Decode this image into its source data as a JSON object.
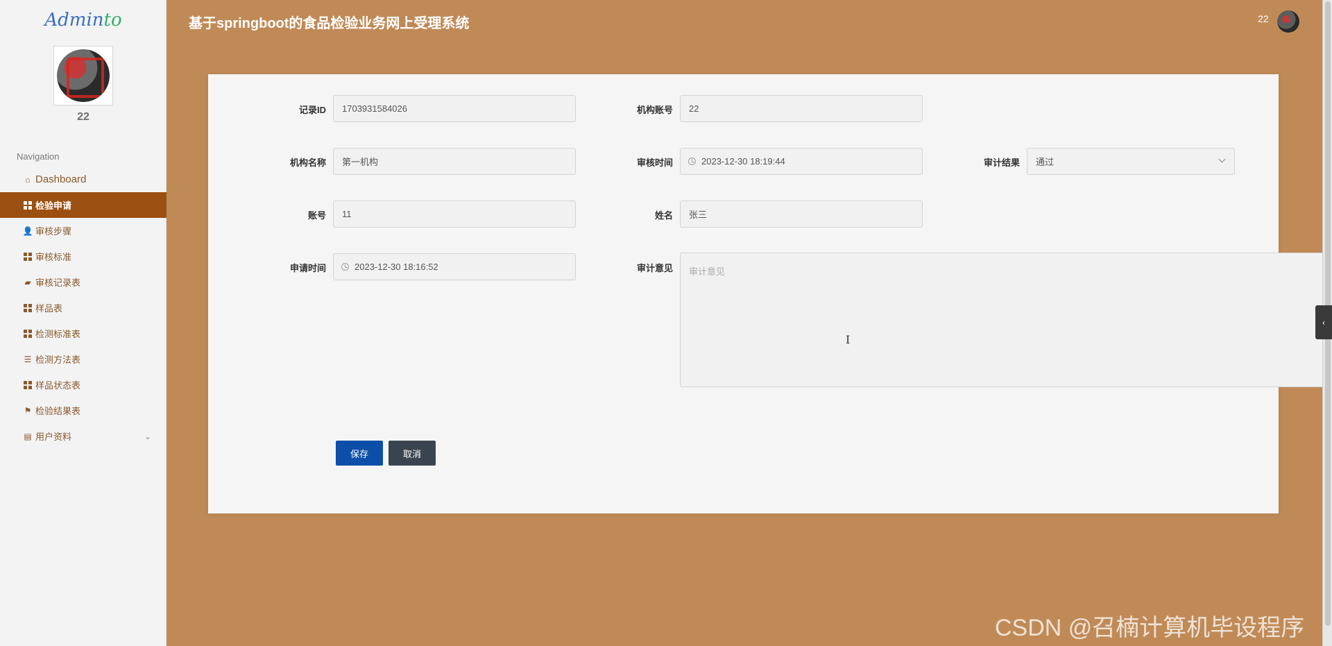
{
  "logo": {
    "part1": "Admin",
    "part2": "to"
  },
  "sidebar": {
    "user_name": "22",
    "nav_title": "Navigation",
    "items": [
      {
        "label": "Dashboard",
        "icon": "home-icon"
      },
      {
        "label": "检验申请",
        "icon": "grid-icon",
        "active": true
      },
      {
        "label": "审核步骤",
        "icon": "user-icon"
      },
      {
        "label": "审核标准",
        "icon": "grid-icon"
      },
      {
        "label": "审核记录表",
        "icon": "ticket-icon"
      },
      {
        "label": "样品表",
        "icon": "grid-icon"
      },
      {
        "label": "检测标准表",
        "icon": "grid-icon"
      },
      {
        "label": "检测方法表",
        "icon": "sliders-icon"
      },
      {
        "label": "样品状态表",
        "icon": "grid-icon"
      },
      {
        "label": "检验结果表",
        "icon": "flag-icon"
      },
      {
        "label": "用户资料",
        "icon": "card-icon",
        "has_submenu": true
      }
    ]
  },
  "header": {
    "title": "基于springboot的食品检验业务网上受理系统",
    "user": "22"
  },
  "form": {
    "record_id": {
      "label": "记录ID",
      "value": "1703931584026"
    },
    "org_account": {
      "label": "机构账号",
      "value": "22"
    },
    "org_name": {
      "label": "机构名称",
      "value": "第一机构"
    },
    "review_time": {
      "label": "审核时间",
      "value": "2023-12-30 18:19:44"
    },
    "audit_result": {
      "label": "审计结果",
      "value": "通过"
    },
    "account": {
      "label": "账号",
      "value": "11"
    },
    "name": {
      "label": "姓名",
      "value": "张三"
    },
    "apply_time": {
      "label": "申请时间",
      "value": "2023-12-30 18:16:52"
    },
    "audit_opinion": {
      "label": "审计意见",
      "placeholder": "审计意见"
    },
    "save_label": "保存",
    "cancel_label": "取消"
  },
  "watermark": "CSDN @召楠计算机毕设程序"
}
